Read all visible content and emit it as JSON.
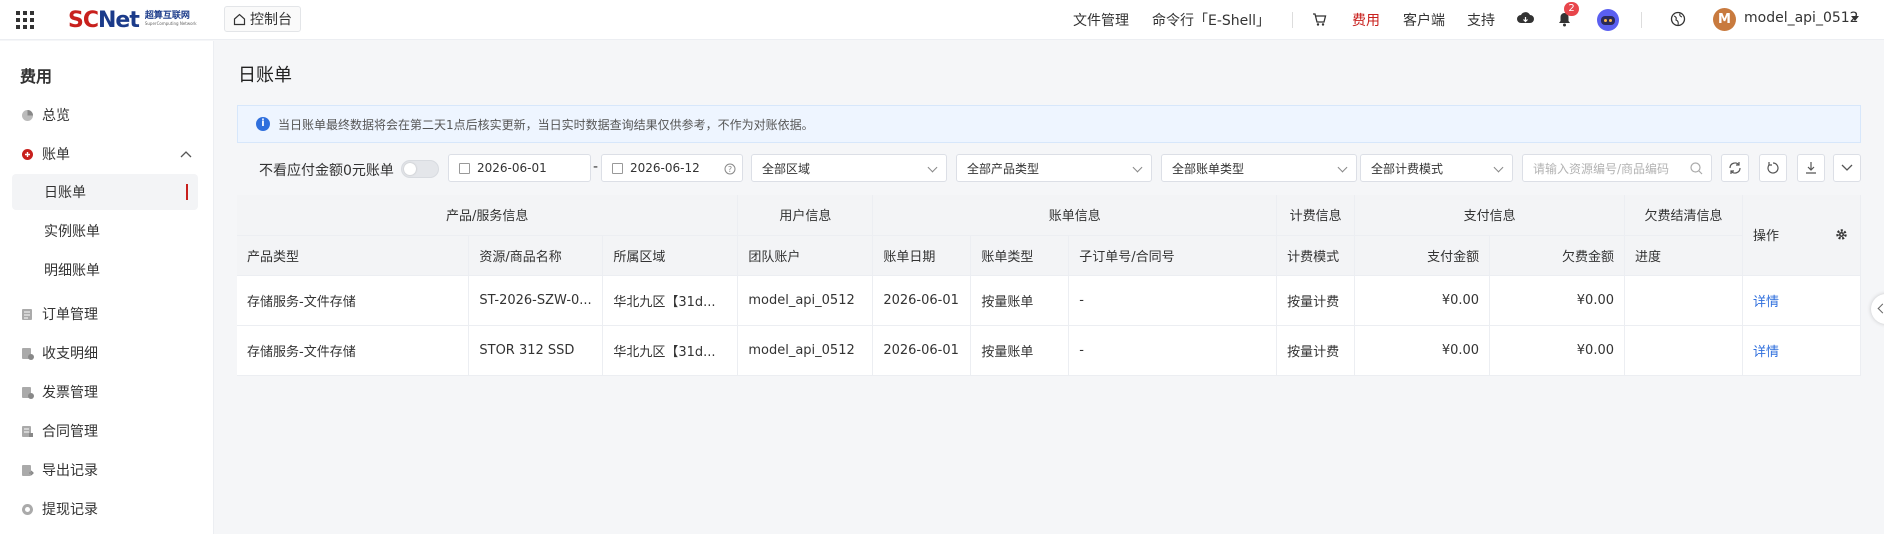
{
  "topbar": {
    "logo_text_red": "SC",
    "logo_text_blue": "Net",
    "logo_cn": "超算互联网",
    "logo_en": "SuperComputing Network",
    "console": "控制台",
    "nav": [
      "文件管理",
      "命令行「E-Shell」",
      "费用",
      "客户端",
      "支持"
    ],
    "active_nav": "费用",
    "notification_count": "2",
    "avatar_letter": "M",
    "username": "model_api_0512",
    "accent": "#c8201d"
  },
  "sidebar": {
    "title": "费用",
    "items": [
      {
        "label": "总览",
        "icon": "pie-chart-icon"
      },
      {
        "label": "账单",
        "icon": "bill-icon"
      },
      {
        "label": "订单管理",
        "icon": "order-icon"
      },
      {
        "label": "收支明细",
        "icon": "ledger-icon"
      },
      {
        "label": "发票管理",
        "icon": "invoice-icon"
      },
      {
        "label": "合同管理",
        "icon": "contract-icon"
      },
      {
        "label": "导出记录",
        "icon": "export-icon"
      },
      {
        "label": "提现记录",
        "icon": "withdraw-icon"
      }
    ],
    "sub_items": [
      "日账单",
      "实例账单",
      "明细账单"
    ],
    "active_sub": "日账单"
  },
  "main": {
    "title": "日账单",
    "notice": "当日账单最终数据将会在第二天1点后核实更新，当日实时数据查询结果仅供参考，不作为对账依据。",
    "filters": {
      "zero_toggle_label": "不看应付金额0元账单",
      "zero_toggle_on": false,
      "date_start": "2026-06-01",
      "date_end": "2026-06-12",
      "date_sep": "-",
      "region": "全部区域",
      "product_type": "全部产品类型",
      "bill_type": "全部账单类型",
      "billing_mode": "全部计费模式",
      "search_placeholder": "请输入资源编号/商品编码"
    },
    "table": {
      "groups": [
        "产品/服务信息",
        "用户信息",
        "账单信息",
        "计费信息",
        "支付信息",
        "欠费结清信息",
        "操作"
      ],
      "columns": [
        "产品类型",
        "资源/商品名称",
        "所属区域",
        "团队账户",
        "账单日期",
        "账单类型",
        "子订单号/合同号",
        "计费模式",
        "支付金额",
        "欠费金额",
        "进度"
      ],
      "rows": [
        [
          "存储服务-文件存储",
          "ST-2026-SZW-0...",
          "华北九区【31d...",
          "model_api_0512",
          "2026-06-01",
          "按量账单",
          "-",
          "按量计费",
          "¥0.00",
          "¥0.00",
          "",
          "详情"
        ],
        [
          "存储服务-文件存储",
          "STOR 312 SSD",
          "华北九区【31d...",
          "model_api_0512",
          "2026-06-01",
          "按量账单",
          "-",
          "按量计费",
          "¥0.00",
          "¥0.00",
          "",
          "详情"
        ]
      ]
    }
  }
}
